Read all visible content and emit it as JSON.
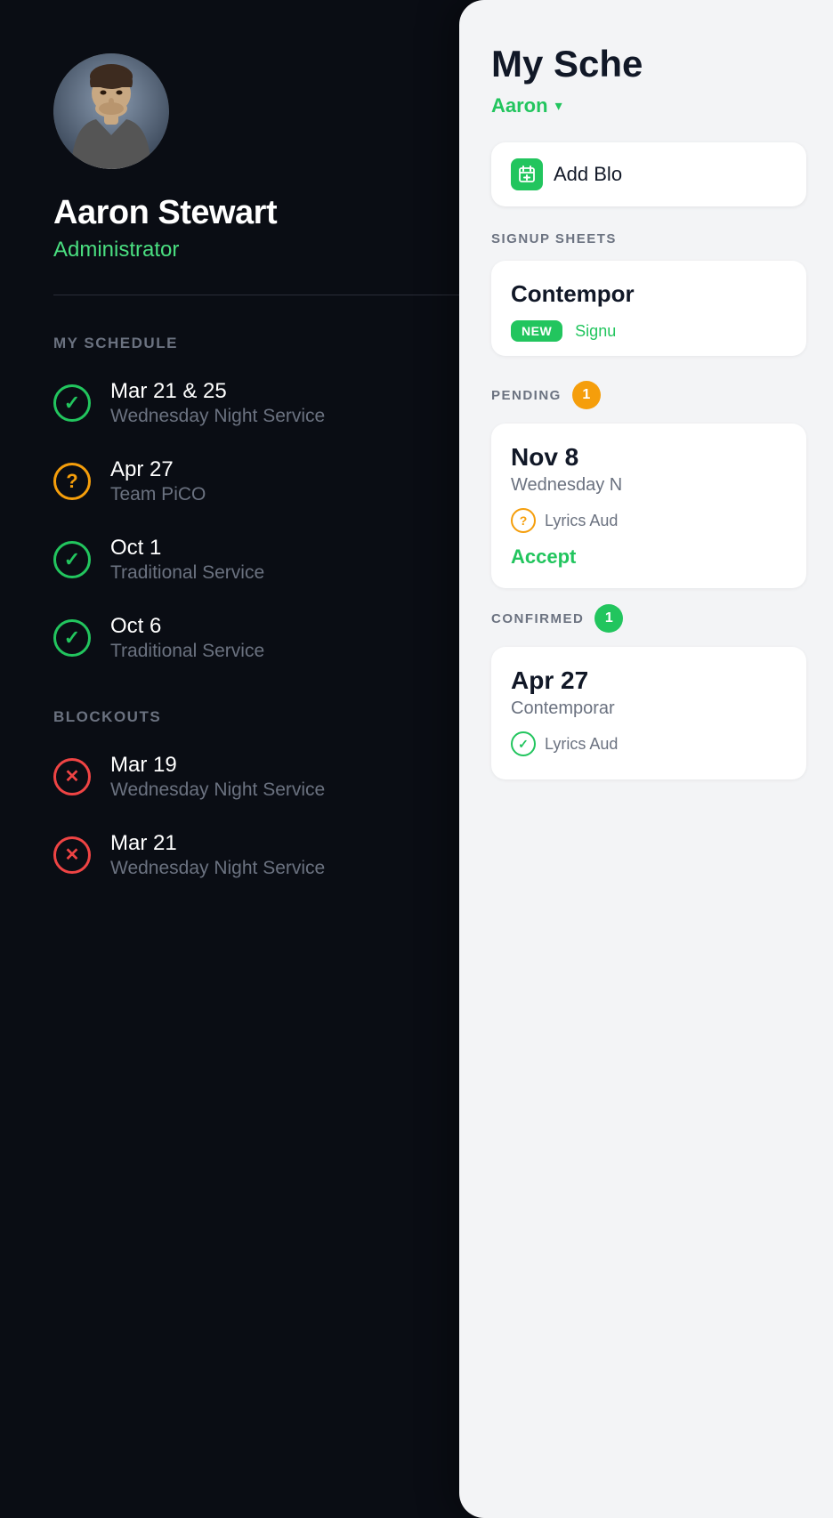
{
  "left": {
    "user": {
      "name": "Aaron Stewart",
      "role": "Administrator"
    },
    "my_schedule_label": "MY SCHEDULE",
    "schedule_items": [
      {
        "date": "Mar 21 & 25",
        "service": "Wednesday Night Service",
        "status": "confirmed"
      },
      {
        "date": "Apr 27",
        "service": "Team PiCO",
        "status": "pending"
      },
      {
        "date": "Oct 1",
        "service": "Traditional Service",
        "status": "confirmed"
      },
      {
        "date": "Oct 6",
        "service": "Traditional Service",
        "status": "confirmed"
      }
    ],
    "blockouts_label": "BLOCKOUTS",
    "blockout_items": [
      {
        "date": "Mar 19",
        "service": "Wednesday Night Service",
        "status": "blocked"
      },
      {
        "date": "Mar 21",
        "service": "Wednesday Night Service",
        "status": "blocked"
      }
    ]
  },
  "right": {
    "title": "My Sche",
    "title_full": "My Schedule",
    "user_name": "Aaron",
    "add_block_label": "Add Blo",
    "add_block_full": "Add Blockout",
    "signup_sheets_label": "SIGNUP SHEETS",
    "signup_card": {
      "title": "Contempor",
      "title_full": "Contemporary",
      "tag_new": "NEW",
      "tag_signup": "Signu",
      "tag_signup_full": "Signup"
    },
    "pending_label": "PENDING",
    "pending_count": "1",
    "pending_card": {
      "date": "Nov 8",
      "service": "Wednesday N",
      "service_full": "Wednesday Night",
      "role": "Lyrics Aud",
      "role_full": "Lyrics Audio",
      "accept_label": "Accept"
    },
    "confirmed_label": "CONFIRMED",
    "confirmed_count": "1",
    "confirmed_card": {
      "date": "Apr 27",
      "service": "Contemporar",
      "service_full": "Contemporary",
      "role": "Lyrics Aud",
      "role_full": "Lyrics Audio"
    }
  }
}
